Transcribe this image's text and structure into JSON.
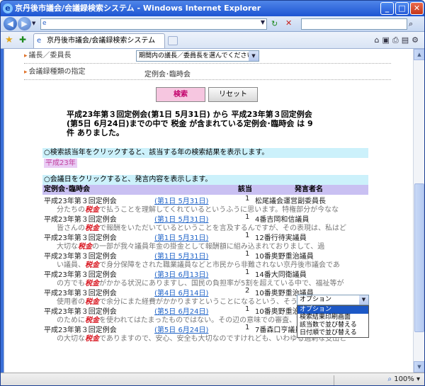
{
  "window": {
    "title": "京丹後市議会/会議録検索システム - Windows Internet Explorer"
  },
  "tab": {
    "title": "京丹後市議会/会議録検索システム"
  },
  "browser": {
    "zoom": "100%"
  },
  "filters": {
    "speaker_role_label": "議長／委員長",
    "speaker_role_value": "期間内の議長／委員長を選んでください",
    "meeting_kind_label": "会議録種類の指定",
    "meeting_kind_value": "定例会･臨時会"
  },
  "buttons": {
    "search": "検索",
    "reset": "リセット"
  },
  "summary": {
    "line1": "平成23年第３回定例会(第1日 5月31日)  から   平成23年第３回定例会",
    "line2": "(第5日 6月24日)までの中で  税金  が含まれている定例会･臨時会 は  9",
    "line3": "件   ありました。"
  },
  "year_hint": "○検索該当年をクリックすると、該当する年の検索結果を表示します。",
  "year_link": "平成23年",
  "date_hint": "○会議日をクリックすると、発言内容を表示します。",
  "table_headers": {
    "meeting": "定例会･臨時会",
    "hits": "該当",
    "speaker": "発言者名"
  },
  "results": [
    {
      "meeting": "平成23年第３回定例会",
      "date": "(第1日 5月31日)",
      "hits": "1",
      "speaker": "松尾議会運営副委員長",
      "pre": "分たちの",
      "kw": "税金",
      "post": "で払うことを理解してくれているというふうに思います。特権部分が今なな"
    },
    {
      "meeting": "平成23年第３回定例会",
      "date": "(第1日 5月31日)",
      "hits": "1",
      "speaker": "4番吉岡和信議員",
      "pre": "皆さんの",
      "kw": "税金",
      "post": "で報酬をいただいているということを言及するんですが、その表現は、私はど"
    },
    {
      "meeting": "平成23年第３回定例会",
      "date": "(第1日 5月31日)",
      "hits": "1",
      "speaker": "12番行待実議員",
      "pre": "大切な",
      "kw": "税金",
      "post": "の一部が我々議員年金の掛金として報酬額に組み込まれておりまして、過"
    },
    {
      "meeting": "平成23年第３回定例会",
      "date": "(第1日 5月31日)",
      "hits": "1",
      "speaker": "10番奥野重治議員",
      "pre": "い議員、",
      "kw": "税金",
      "post": "で身分保障をされた職業議員などと市民から非難されない京丹後市議会であ"
    },
    {
      "meeting": "平成23年第３回定例会",
      "date": "(第3日 6月13日)",
      "hits": "1",
      "speaker": "14番大同衛議員",
      "pre": "の方でも",
      "kw": "税金",
      "post": "がかかる状況にありますし、国民の負担率が5割を超えている中で、福祉等が"
    },
    {
      "meeting": "平成23年第３回定例会",
      "date": "(第4日 6月14日)",
      "hits": "2",
      "speaker": "10番奥野重治議員",
      "pre": "使用者の",
      "kw": "税金",
      "post": "で余分にまた経費がかかりますということになるという、そういう考え方で"
    },
    {
      "meeting": "平成23年第３回定例会",
      "date": "(第5日 6月24日)",
      "hits": "1",
      "speaker": "10番奥野重治議員",
      "pre": "のために",
      "kw": "税金",
      "post": "を使われてはたまったものではない。その辺の意味での審査、可決する、否"
    },
    {
      "meeting": "平成23年第３回定例会",
      "date": "(第5日 6月24日)",
      "hits": "1",
      "speaker": "7番森口亨議員",
      "pre": "の大切な",
      "kw": "税金",
      "post": "でありますので、安心、安全も大切なのですけれども、いわゆる過剰な支出と"
    }
  ],
  "options": {
    "selected": "オプション",
    "items": [
      "オプション",
      "検索結果印刷画面",
      "該当数で並び替える",
      "日付順で並び替える"
    ]
  }
}
